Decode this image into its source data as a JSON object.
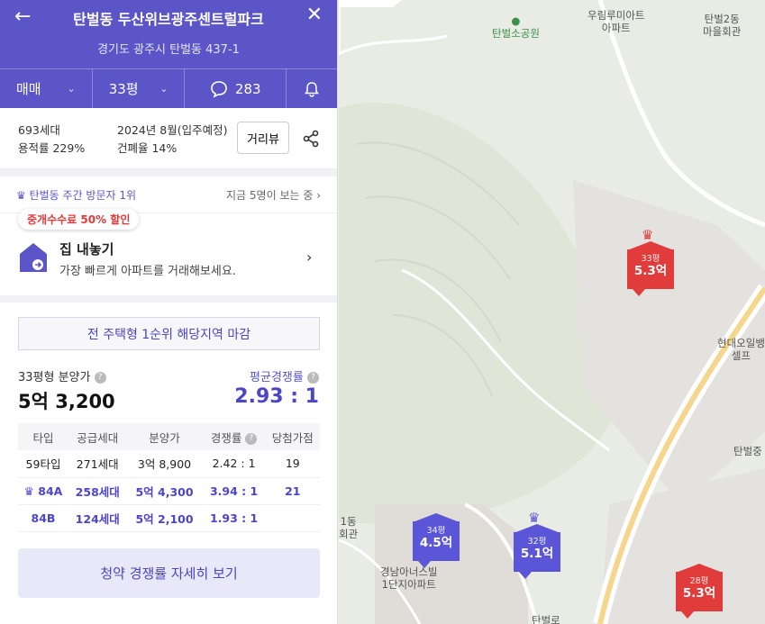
{
  "header": {
    "title": "탄벌동 두산위브광주센트럴파크",
    "address": "경기도 광주시 탄벌동 437-1",
    "deal_type": "매매",
    "size": "33평",
    "comment_count": "283"
  },
  "info": {
    "households": "693세대",
    "floor_area_ratio": "용적률 229%",
    "move_in": "2024년 8월(입주예정)",
    "coverage_ratio": "건폐율 14%",
    "roadview_label": "거리뷰"
  },
  "visit": {
    "rank_text": "탄벌동 주간 방문자 1위",
    "viewers_text": "지금 5명이 보는 중"
  },
  "promo": {
    "badge": "중개수수료 50% 할인",
    "title": "집 내놓기",
    "subtitle": "가장 빠르게 아파트를 거래해보세요."
  },
  "notice": "전 주택형 1순위 해당지역 마감",
  "price": {
    "label": "33평형 분양가",
    "value": "5억 3,200",
    "comp_label": "평균경쟁률",
    "comp_value": "2.93 : 1"
  },
  "table": {
    "headers": [
      "타입",
      "공급세대",
      "분양가",
      "경쟁률",
      "당첨가점"
    ],
    "rows": [
      {
        "type": "59타입",
        "supply": "271세대",
        "price": "3억 8,900",
        "rate": "2.42 : 1",
        "score": "19",
        "highlight": false
      },
      {
        "type": "84A",
        "supply": "258세대",
        "price": "5억 4,300",
        "rate": "3.94 : 1",
        "score": "21",
        "highlight": true
      },
      {
        "type": "84B",
        "supply": "124세대",
        "price": "5억 2,100",
        "rate": "1.93 : 1",
        "score": "",
        "highlight": true
      }
    ]
  },
  "detail_button": "청약 경쟁률 자세히 보기",
  "map": {
    "labels": {
      "park": "탄벌소공원",
      "apt": "우림루미아트\n아파트",
      "office": "탄벌2동\n마을회관",
      "gas": "현대오일뱅\n셀프",
      "hall1": "1동\n회관",
      "villa": "경남아너스빌\n1단지아파트",
      "tanbeol_right": "탄벌중",
      "road": "탄벌로"
    },
    "pins": [
      {
        "size": "33평",
        "price": "5.3억",
        "color": "red",
        "crown": true
      },
      {
        "size": "34평",
        "price": "4.5억",
        "color": "blue",
        "crown": false
      },
      {
        "size": "32평",
        "price": "5.1억",
        "color": "blue",
        "crown": true
      },
      {
        "size": "28평",
        "price": "5.3억",
        "color": "red",
        "crown": false
      }
    ]
  }
}
